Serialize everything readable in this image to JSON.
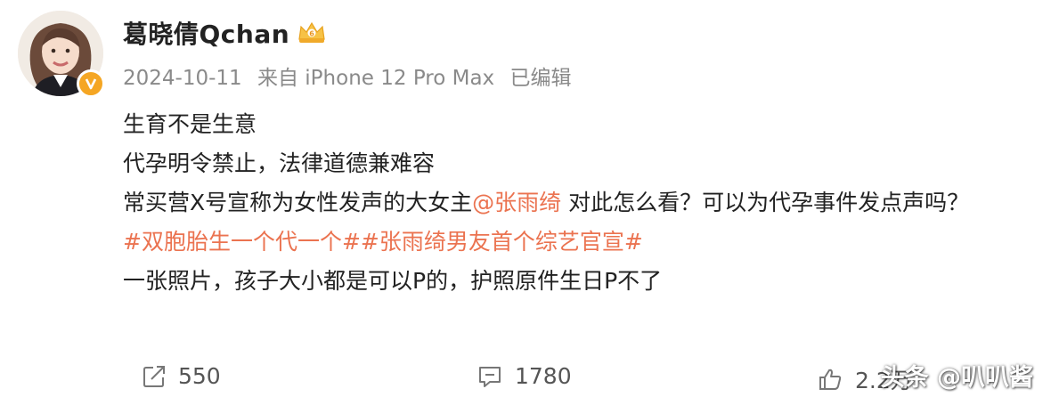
{
  "post": {
    "username": "葛晓倩Qchan",
    "meta": {
      "date": "2024-10-11",
      "source": "来自 iPhone 12 Pro Max",
      "edited": "已编辑"
    },
    "lines": [
      "生育不是生意",
      "代孕明令禁止，法律道德兼难容"
    ],
    "line3_prefix": "常买营X号宣称为女性发声的大女主",
    "mention": "@张雨绮",
    "line3_suffix": "  对此怎么看？可以为代孕事件发点声吗？",
    "hashtags": "#双胞胎生一个代一个##张雨绮男友首个综艺官宣#",
    "last_line": "一张照片，孩子大小都是可以P的，护照原件生日P不了"
  },
  "actions": {
    "repost_count": "550",
    "comment_count": "1780",
    "like_count": "2.2万"
  },
  "watermark": "头条 @叭叭酱",
  "colors": {
    "accent": "#eb7350",
    "meta": "#8a8a8a",
    "verified": "#f5a623"
  },
  "icons": [
    "avatar",
    "verified-icon",
    "vip-crown-icon",
    "repost-icon",
    "comment-icon",
    "like-icon"
  ]
}
